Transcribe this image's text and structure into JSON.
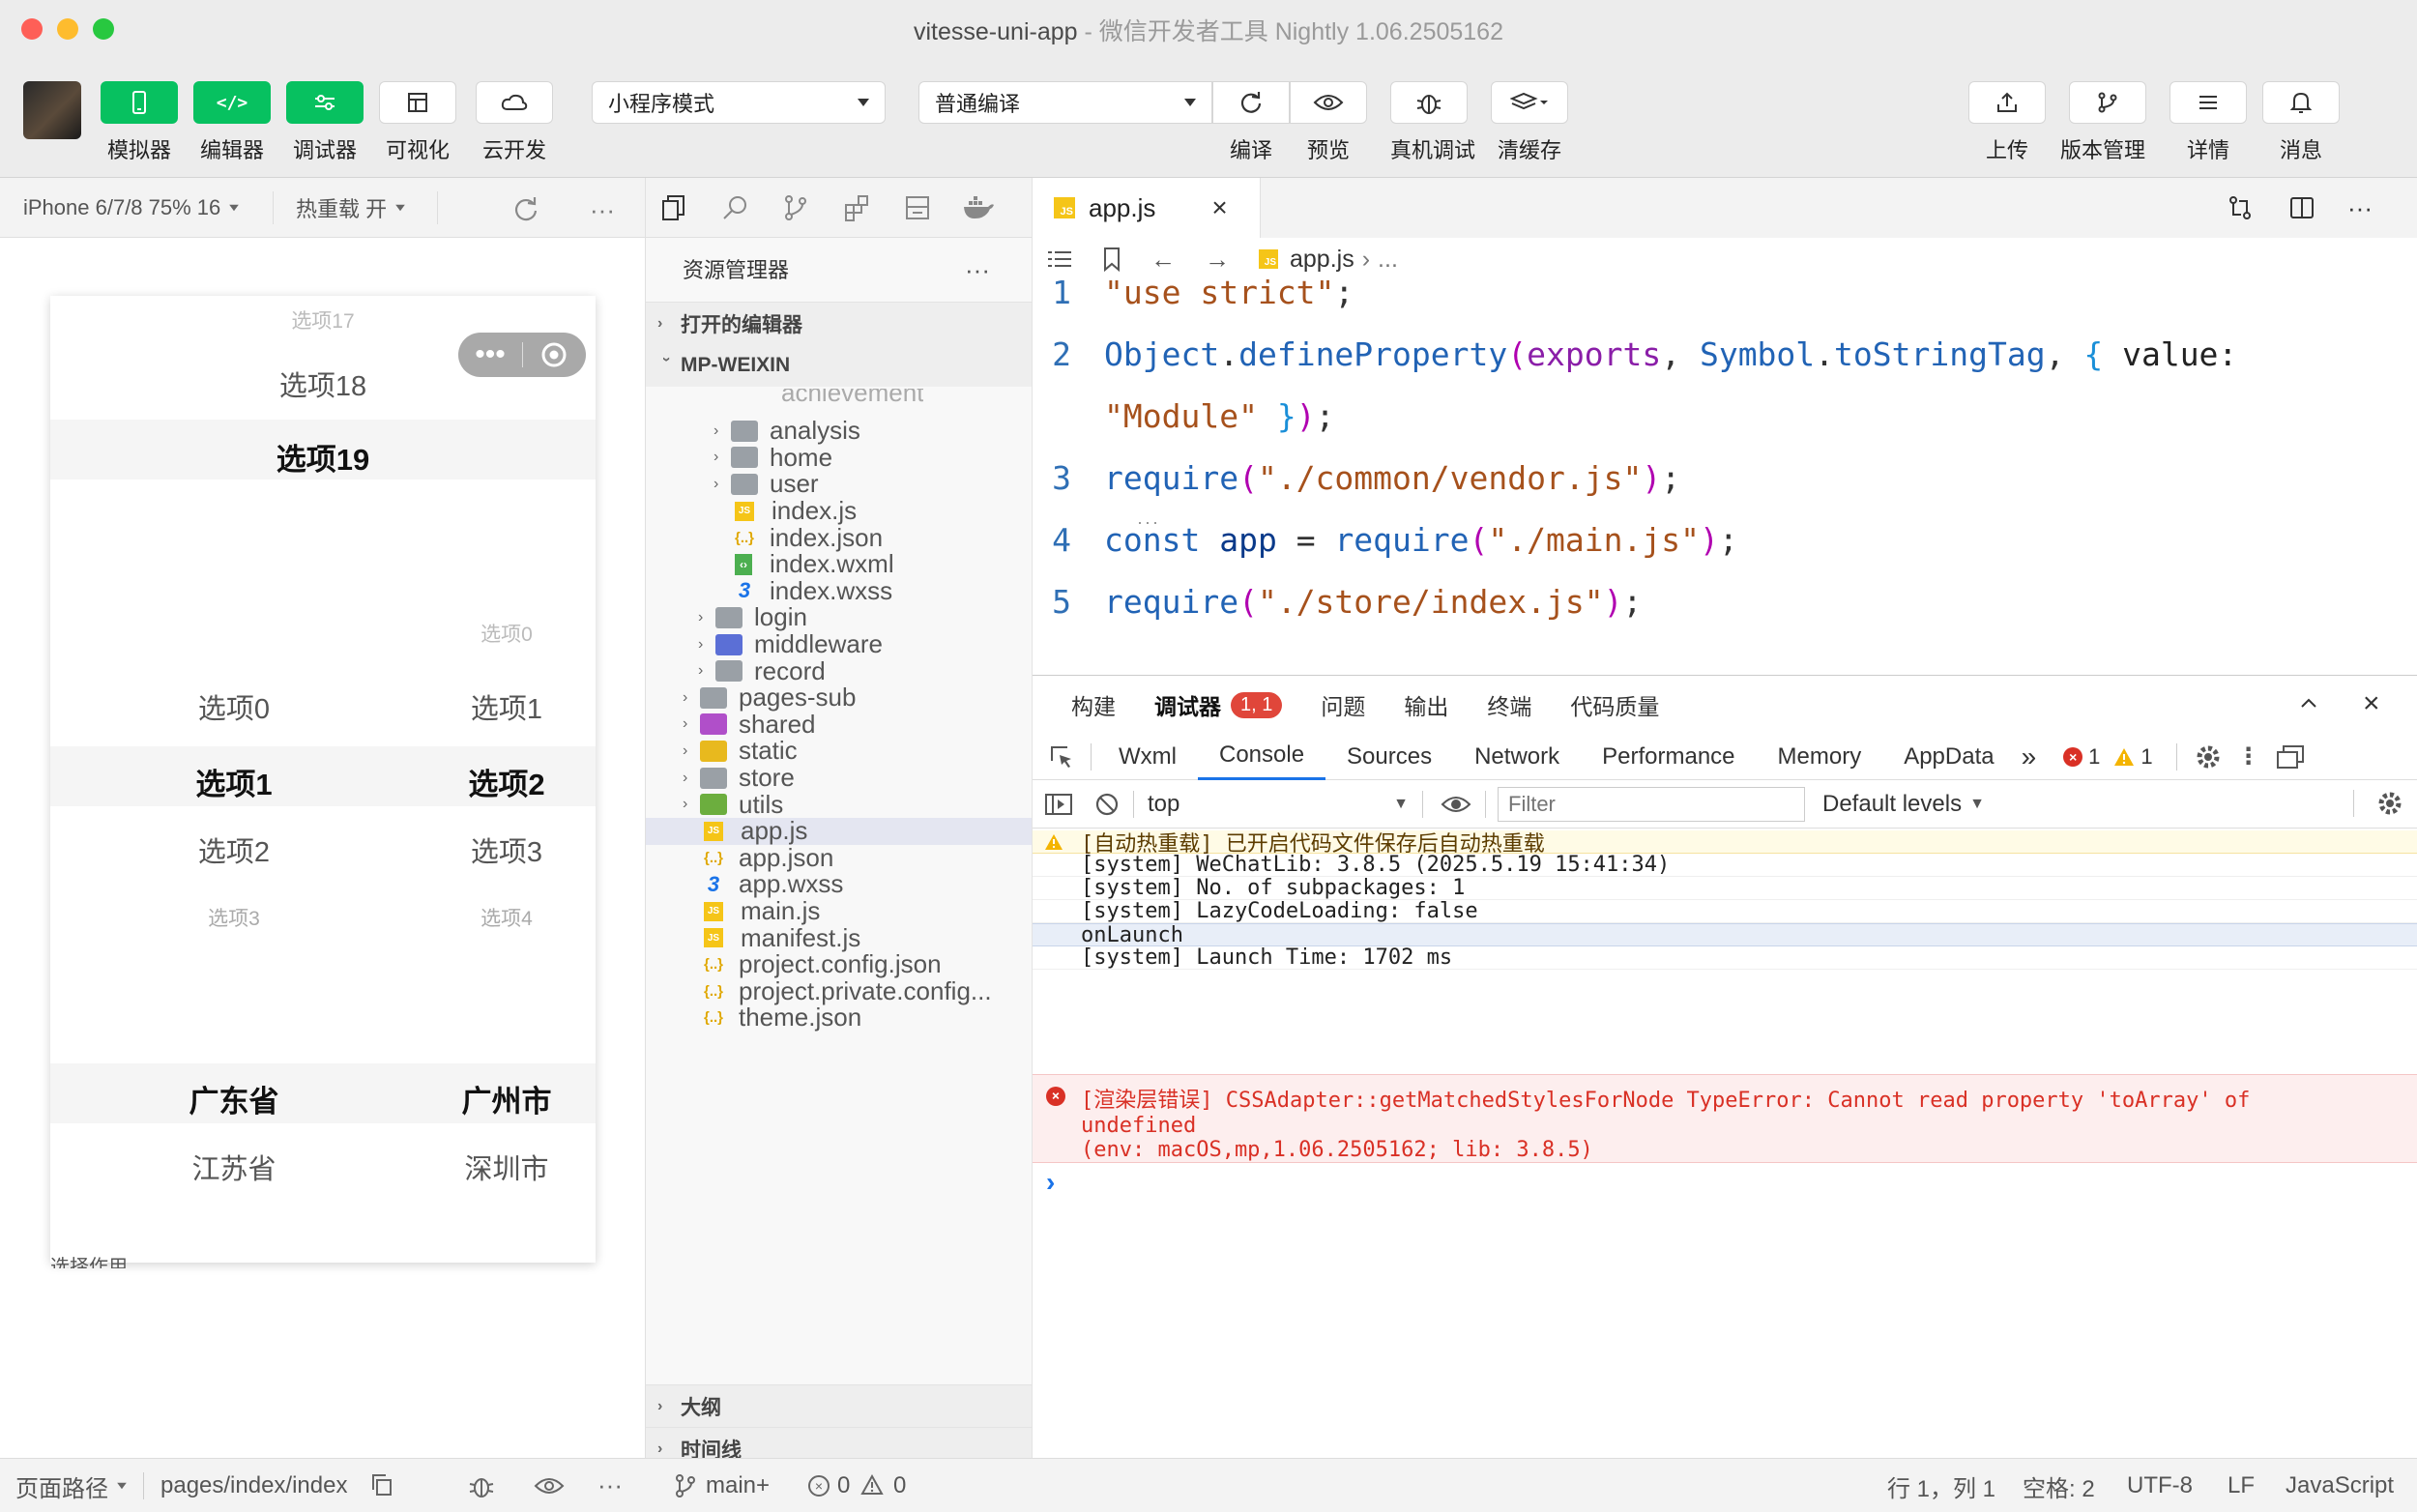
{
  "window": {
    "title": "vitesse-uni-app",
    "subtitle": " - 微信开发者工具 Nightly 1.06.2505162"
  },
  "toolbar": {
    "left_buttons": [
      "模拟器",
      "编辑器",
      "调试器",
      "可视化",
      "云开发"
    ],
    "mode_select": "小程序模式",
    "compile_select": "普通编译",
    "center_buttons": [
      "编译",
      "预览",
      "真机调试",
      "清缓存"
    ],
    "right_buttons": [
      "上传",
      "版本管理",
      "详情",
      "消息"
    ]
  },
  "simulator": {
    "device": "iPhone 6/7/8 75% 16",
    "hot_reload": "热重载 开",
    "picker1": {
      "items": [
        "选项17",
        "选项18",
        "选项19"
      ]
    },
    "picker2": {
      "col1": [
        "选项0",
        "选项1",
        "选项2",
        "选项3"
      ],
      "col2": [
        "选项0",
        "选项1",
        "选项2",
        "选项3",
        "选项4"
      ]
    },
    "picker3": {
      "col1": [
        "广东省",
        "江苏省"
      ],
      "col2": [
        "广州市",
        "深圳市"
      ]
    },
    "cutoff_text": "选择作用"
  },
  "explorer": {
    "title": "资源管理器",
    "open_editors": "打开的编辑器",
    "project": "MP-WEIXIN",
    "partial_top": "achievement",
    "tree": [
      {
        "name": "analysis",
        "kind": "folder",
        "depth": 2
      },
      {
        "name": "home",
        "kind": "folder",
        "depth": 2
      },
      {
        "name": "user",
        "kind": "folder",
        "depth": 2
      },
      {
        "name": "index.js",
        "kind": "js",
        "depth": 2
      },
      {
        "name": "index.json",
        "kind": "json",
        "depth": 2
      },
      {
        "name": "index.wxml",
        "kind": "wxml",
        "depth": 2
      },
      {
        "name": "index.wxss",
        "kind": "wxss",
        "depth": 2
      },
      {
        "name": "login",
        "kind": "folder",
        "depth": 1
      },
      {
        "name": "middleware",
        "kind": "folder-blue",
        "depth": 1
      },
      {
        "name": "record",
        "kind": "folder",
        "depth": 1
      },
      {
        "name": "pages-sub",
        "kind": "folder",
        "depth": 0
      },
      {
        "name": "shared",
        "kind": "folder-purple",
        "depth": 0
      },
      {
        "name": "static",
        "kind": "folder-yellow",
        "depth": 0
      },
      {
        "name": "store",
        "kind": "folder",
        "depth": 0
      },
      {
        "name": "utils",
        "kind": "folder-green",
        "depth": 0
      },
      {
        "name": "app.js",
        "kind": "js",
        "depth": 0,
        "selected": true
      },
      {
        "name": "app.json",
        "kind": "json",
        "depth": 0
      },
      {
        "name": "app.wxss",
        "kind": "wxss",
        "depth": 0
      },
      {
        "name": "main.js",
        "kind": "js",
        "depth": 0
      },
      {
        "name": "manifest.js",
        "kind": "js",
        "depth": 0
      },
      {
        "name": "project.config.json",
        "kind": "json",
        "depth": 0
      },
      {
        "name": "project.private.config...",
        "kind": "json",
        "depth": 0
      },
      {
        "name": "theme.json",
        "kind": "json",
        "depth": 0
      }
    ],
    "outline": "大纲",
    "timeline": "时间线"
  },
  "editor": {
    "tab": "app.js",
    "breadcrumb": "app.js",
    "breadcrumb_more": "...",
    "lines": [
      {
        "n": "1",
        "tokens": [
          {
            "t": "\"use strict\"",
            "c": "#a6511c"
          },
          {
            "t": ";",
            "c": "#333"
          }
        ]
      },
      {
        "n": "2",
        "tokens": [
          {
            "t": "Object",
            "c": "#2163b5"
          },
          {
            "t": ".",
            "c": "#333"
          },
          {
            "t": "defineProperty",
            "c": "#2163b5"
          },
          {
            "t": "(",
            "c": "#b000b0"
          },
          {
            "t": "exports",
            "c": "#8a1ea8"
          },
          {
            "t": ", ",
            "c": "#333"
          },
          {
            "t": "Symbol",
            "c": "#2163b5"
          },
          {
            "t": ".",
            "c": "#333"
          },
          {
            "t": "toStringTag",
            "c": "#2163b5"
          },
          {
            "t": ", ",
            "c": "#333"
          },
          {
            "t": "{",
            "c": "#1a8fd8"
          },
          {
            "t": " value:",
            "c": "#222"
          }
        ]
      },
      {
        "n": "",
        "tokens": [
          {
            "t": "\"Module\"",
            "c": "#a6511c"
          },
          {
            "t": " ",
            "c": "#333"
          },
          {
            "t": "}",
            "c": "#1a8fd8"
          },
          {
            "t": ")",
            "c": "#b000b0"
          },
          {
            "t": ";",
            "c": "#333"
          }
        ]
      },
      {
        "n": "3",
        "tokens": [
          {
            "t": "require",
            "c": "#2163b5"
          },
          {
            "t": "(",
            "c": "#b000b0"
          },
          {
            "t": "\"./common/vendor.js\"",
            "c": "#a6511c"
          },
          {
            "t": ")",
            "c": "#b000b0"
          },
          {
            "t": ";",
            "c": "#333"
          }
        ]
      },
      {
        "n": "4",
        "tokens": [
          {
            "t": "const ",
            "c": "#2163b5"
          },
          {
            "t": "app",
            "c": "#0a3a8a"
          },
          {
            "t": " = ",
            "c": "#333"
          },
          {
            "t": "require",
            "c": "#2163b5"
          },
          {
            "t": "(",
            "c": "#b000b0"
          },
          {
            "t": "\"./main.js\"",
            "c": "#a6511c"
          },
          {
            "t": ")",
            "c": "#b000b0"
          },
          {
            "t": ";",
            "c": "#333"
          }
        ]
      },
      {
        "n": "5",
        "tokens": [
          {
            "t": "require",
            "c": "#2163b5"
          },
          {
            "t": "(",
            "c": "#b000b0"
          },
          {
            "t": "\"./store/index.js\"",
            "c": "#a6511c"
          },
          {
            "t": ")",
            "c": "#b000b0"
          },
          {
            "t": ";",
            "c": "#333"
          }
        ]
      }
    ]
  },
  "devtools": {
    "tabs": [
      "构建",
      "调试器",
      "问题",
      "输出",
      "终端",
      "代码质量"
    ],
    "debugger_badge": "1, 1",
    "console_tabs": [
      "Wxml",
      "Console",
      "Sources",
      "Network",
      "Performance",
      "Memory",
      "AppData"
    ],
    "error_count": "1",
    "warning_count": "1",
    "context": "top",
    "filter_placeholder": "Filter",
    "levels": "Default levels",
    "logs": [
      {
        "kind": "warn",
        "text": "[自动热重载] 已开启代码文件保存后自动热重载"
      },
      {
        "kind": "info",
        "text": "[system] WeChatLib: 3.8.5 (2025.5.19 15:41:34)"
      },
      {
        "kind": "info",
        "text": "[system] No. of subpackages: 1"
      },
      {
        "kind": "info",
        "text": "[system] LazyCodeLoading: false"
      },
      {
        "kind": "highlight",
        "text": "onLaunch"
      },
      {
        "kind": "info",
        "text": "[system] Launch Time: 1702 ms"
      }
    ],
    "error": {
      "line1": "[渲染层错误] CSSAdapter::getMatchedStylesForNode TypeError: Cannot read property 'toArray' of",
      "line2": "undefined",
      "line3": "(env: macOS,mp,1.06.2505162; lib: 3.8.5)"
    },
    "prompt": "›"
  },
  "statusbar": {
    "page_path_label": "页面路径",
    "page_path": "pages/index/index",
    "branch": "main+",
    "errors": "0",
    "warnings": "0",
    "cursor": "行 1，列 1",
    "spaces": "空格: 2",
    "encoding": "UTF-8",
    "eol": "LF",
    "language": "JavaScript"
  },
  "colors": {
    "green": "#07c160",
    "error_bg": "#fdeeee",
    "error_text": "#d93025",
    "warn_bg": "#fffbe6",
    "badge": "#e0463a",
    "highlight_bg": "#e8eef8"
  }
}
